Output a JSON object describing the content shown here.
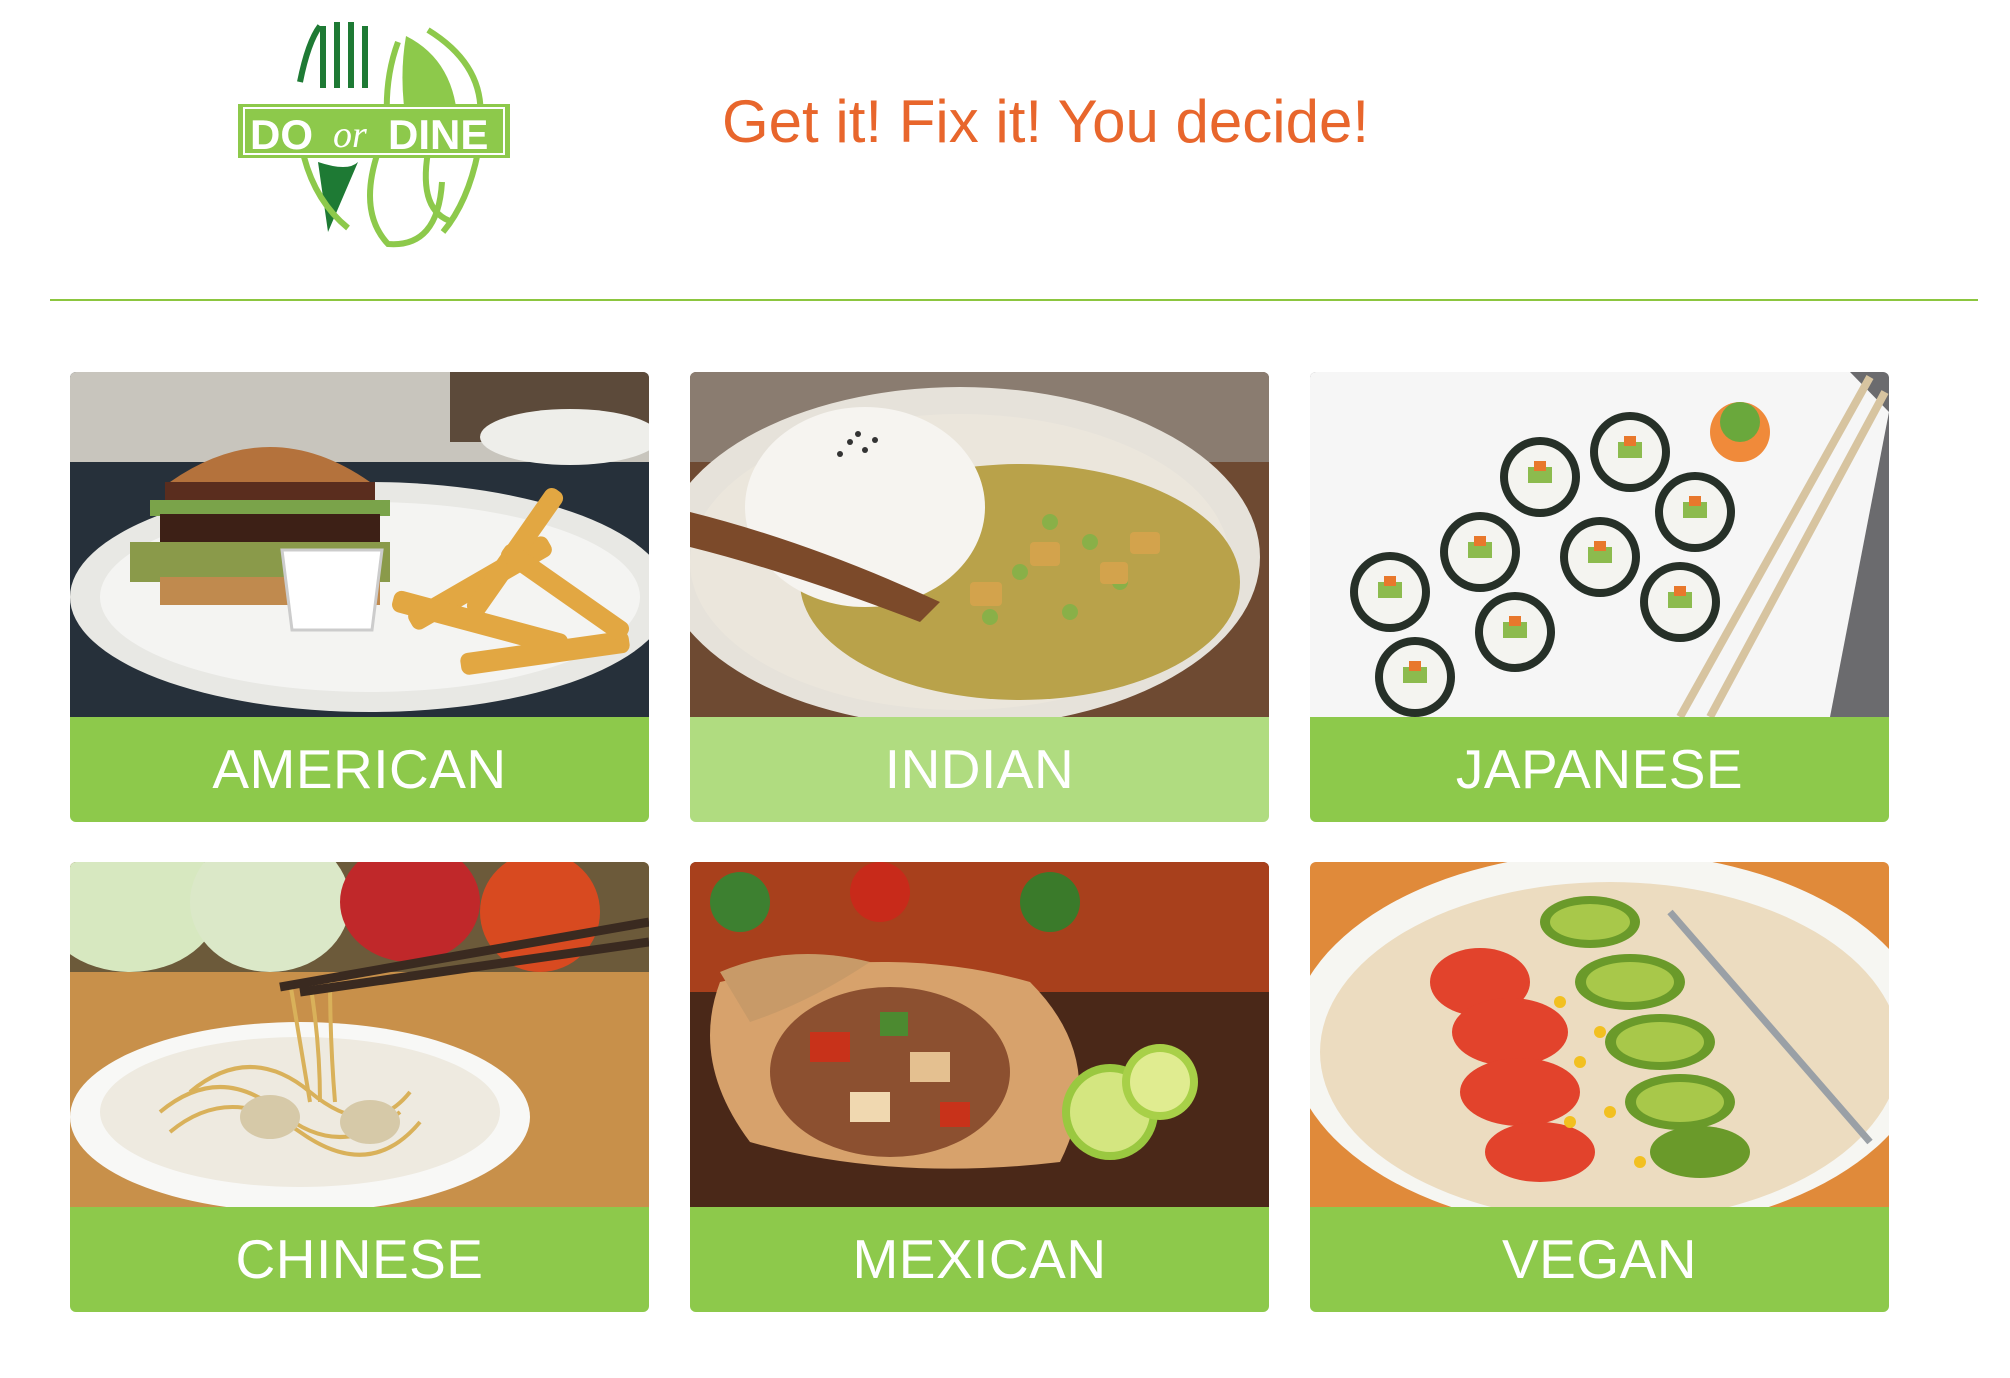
{
  "header": {
    "logo": {
      "part1": "DO",
      "part2": "or",
      "part3": "DINE",
      "icon": "fork-and-spoon-logo"
    },
    "tagline": "Get it! Fix it! You decide!"
  },
  "cuisines": [
    {
      "label": "AMERICAN",
      "image": "burger-and-fries-photo",
      "selected": false
    },
    {
      "label": "INDIAN",
      "image": "curry-and-rice-photo",
      "selected": true
    },
    {
      "label": "JAPANESE",
      "image": "sushi-rolls-photo",
      "selected": false
    },
    {
      "label": "CHINESE",
      "image": "noodles-photo",
      "selected": false
    },
    {
      "label": "MEXICAN",
      "image": "burrito-photo",
      "selected": false
    },
    {
      "label": "VEGAN",
      "image": "avocado-tomato-wrap-photo",
      "selected": false
    }
  ],
  "colors": {
    "brand_green": "#8dc94b",
    "brand_dark_green": "#1e7a34",
    "hover_green": "#b0dc80",
    "tagline_orange": "#e8662c"
  }
}
